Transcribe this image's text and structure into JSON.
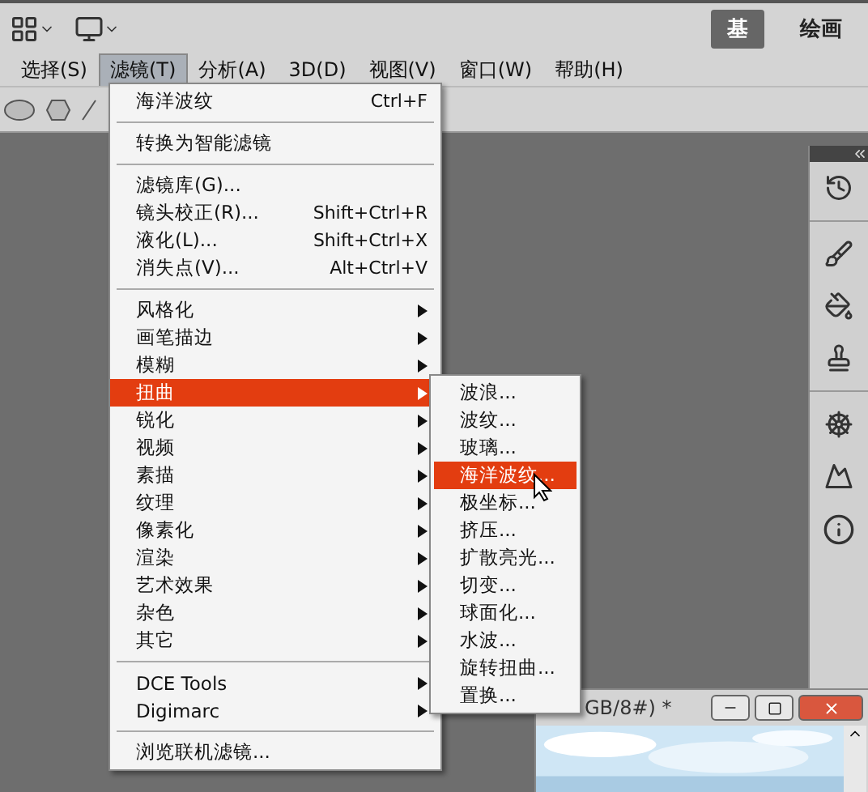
{
  "workspace_buttons": [
    {
      "label": "基",
      "selected": true
    },
    {
      "label": "绘画",
      "selected": false
    }
  ],
  "menubar": [
    {
      "label": "选择(S)",
      "selected": false
    },
    {
      "label": "滤镜(T)",
      "selected": true
    },
    {
      "label": "分析(A)",
      "selected": false
    },
    {
      "label": "3D(D)",
      "selected": false
    },
    {
      "label": "视图(V)",
      "selected": false
    },
    {
      "label": "窗口(W)",
      "selected": false
    },
    {
      "label": "帮助(H)",
      "selected": false
    }
  ],
  "filter_menu": [
    {
      "kind": "item",
      "label": "海洋波纹",
      "shortcut": "Ctrl+F",
      "submenu": false,
      "selected": false
    },
    {
      "kind": "separator"
    },
    {
      "kind": "item",
      "label": "转换为智能滤镜",
      "submenu": false,
      "selected": false
    },
    {
      "kind": "separator"
    },
    {
      "kind": "item",
      "label": "滤镜库(G)...",
      "submenu": false,
      "selected": false
    },
    {
      "kind": "item",
      "label": "镜头校正(R)...",
      "shortcut": "Shift+Ctrl+R",
      "submenu": false,
      "selected": false
    },
    {
      "kind": "item",
      "label": "液化(L)...",
      "shortcut": "Shift+Ctrl+X",
      "submenu": false,
      "selected": false
    },
    {
      "kind": "item",
      "label": "消失点(V)...",
      "shortcut": "Alt+Ctrl+V",
      "submenu": false,
      "selected": false
    },
    {
      "kind": "separator"
    },
    {
      "kind": "item",
      "label": "风格化",
      "submenu": true,
      "selected": false
    },
    {
      "kind": "item",
      "label": "画笔描边",
      "submenu": true,
      "selected": false
    },
    {
      "kind": "item",
      "label": "模糊",
      "submenu": true,
      "selected": false
    },
    {
      "kind": "item",
      "label": "扭曲",
      "submenu": true,
      "selected": true
    },
    {
      "kind": "item",
      "label": "锐化",
      "submenu": true,
      "selected": false
    },
    {
      "kind": "item",
      "label": "视频",
      "submenu": true,
      "selected": false
    },
    {
      "kind": "item",
      "label": "素描",
      "submenu": true,
      "selected": false
    },
    {
      "kind": "item",
      "label": "纹理",
      "submenu": true,
      "selected": false
    },
    {
      "kind": "item",
      "label": "像素化",
      "submenu": true,
      "selected": false
    },
    {
      "kind": "item",
      "label": "渲染",
      "submenu": true,
      "selected": false
    },
    {
      "kind": "item",
      "label": "艺术效果",
      "submenu": true,
      "selected": false
    },
    {
      "kind": "item",
      "label": "杂色",
      "submenu": true,
      "selected": false
    },
    {
      "kind": "item",
      "label": "其它",
      "submenu": true,
      "selected": false
    },
    {
      "kind": "separator"
    },
    {
      "kind": "item",
      "label": "DCE Tools",
      "submenu": true,
      "selected": false
    },
    {
      "kind": "item",
      "label": "Digimarc",
      "submenu": true,
      "selected": false
    },
    {
      "kind": "separator"
    },
    {
      "kind": "item",
      "label": "浏览联机滤镜...",
      "submenu": false,
      "selected": false
    }
  ],
  "distort_submenu": [
    {
      "label": "波浪...",
      "selected": false
    },
    {
      "label": "波纹...",
      "selected": false
    },
    {
      "label": "玻璃...",
      "selected": false
    },
    {
      "label": "海洋波纹...",
      "selected": true
    },
    {
      "label": "极坐标...",
      "selected": false
    },
    {
      "label": "挤压...",
      "selected": false
    },
    {
      "label": "扩散亮光...",
      "selected": false
    },
    {
      "label": "切变...",
      "selected": false
    },
    {
      "label": "球面化...",
      "selected": false
    },
    {
      "label": "水波...",
      "selected": false
    },
    {
      "label": "旋转扭曲...",
      "selected": false
    },
    {
      "label": "置换...",
      "selected": false
    }
  ],
  "document": {
    "title": "GB/8#) *"
  }
}
